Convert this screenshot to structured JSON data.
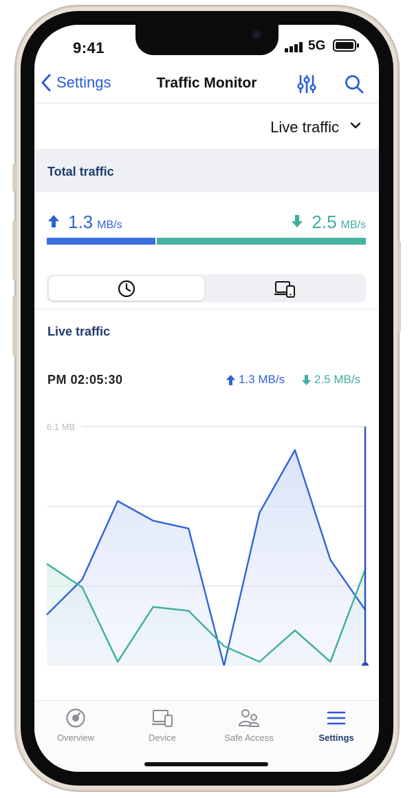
{
  "status_bar": {
    "time": "9:41",
    "network": "5G"
  },
  "nav": {
    "back_label": "Settings",
    "title": "Traffic Monitor"
  },
  "range_selector": {
    "label": "Live traffic"
  },
  "total_section": {
    "title": "Total traffic",
    "upload": {
      "value": "1.3",
      "unit": "MB/s"
    },
    "download": {
      "value": "2.5",
      "unit": "MB/s"
    },
    "upload_fraction": 0.34
  },
  "view_toggle": {
    "selected": "clock-icon"
  },
  "live_section": {
    "title": "Live traffic",
    "time": "PM 02:05:30",
    "upload_text": "1.3 MB/s",
    "download_text": "2.5 MB/s"
  },
  "chart_data": {
    "type": "area",
    "ymax_label": "6.1 MB",
    "ylim": [
      0,
      6.1
    ],
    "grid": true,
    "x": [
      0,
      1,
      2,
      3,
      4,
      5,
      6,
      7,
      8,
      9,
      10
    ],
    "series": [
      {
        "color": "#2f63d6",
        "values": [
          1.3,
          2.2,
          4.2,
          3.7,
          3.5,
          0.0,
          3.9,
          5.5,
          2.7,
          1.4
        ]
      },
      {
        "color": "#3fae9d",
        "values": [
          2.6,
          2.0,
          0.1,
          1.5,
          1.4,
          0.5,
          0.1,
          0.9,
          0.1,
          2.5
        ]
      }
    ]
  },
  "tabs": [
    {
      "label": "Overview",
      "icon": "gauge-icon"
    },
    {
      "label": "Device",
      "icon": "devices-icon"
    },
    {
      "label": "Safe Access",
      "icon": "users-icon"
    },
    {
      "label": "Settings",
      "icon": "menu-icon"
    }
  ],
  "colors": {
    "accent": "#2a5bd7",
    "upload": "#2f63d6",
    "download": "#3fae9d",
    "header_text": "#1f3c6e"
  }
}
